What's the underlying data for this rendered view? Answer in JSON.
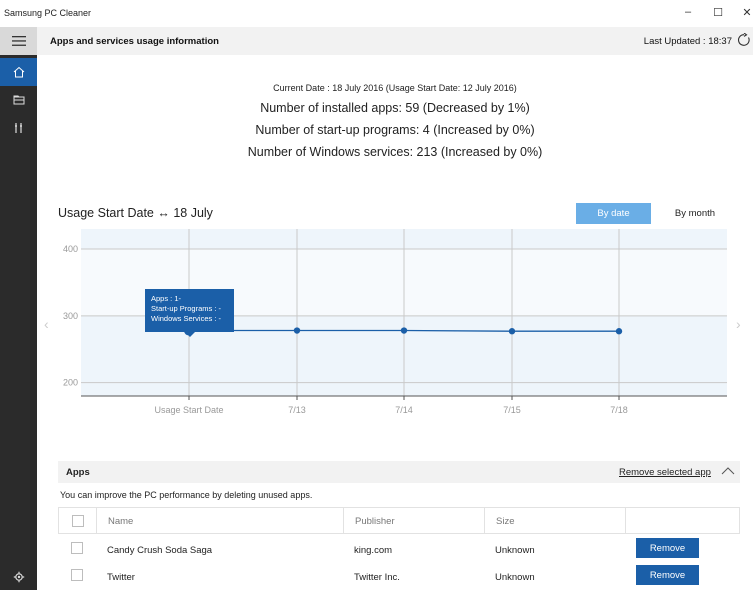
{
  "window": {
    "title": "Samsung PC Cleaner",
    "minimize": "–",
    "maximize": "☐",
    "close": "✕"
  },
  "header": {
    "title": "Apps and services usage information",
    "last_updated": "Last Updated : 18:37"
  },
  "summary": {
    "current_date": "Current Date : 18 July 2016 (Usage Start Date: 12 July 2016)",
    "installed_apps": "Number of installed apps: 59 (Decreased by 1%)",
    "startup_programs": "Number of start-up programs: 4 (Increased by 0%)",
    "windows_services": "Number of Windows services: 213 (Increased by 0%)"
  },
  "chart_header": {
    "title": "Usage Start Date ↔ 18 July",
    "by_date": "By date",
    "by_month": "By month"
  },
  "chart_data": {
    "type": "line",
    "x": [
      "Usage Start Date",
      "7/13",
      "7/14",
      "7/15",
      "7/18"
    ],
    "series": [
      {
        "values": [
          278,
          278,
          278,
          277,
          277
        ]
      }
    ],
    "ylim": [
      180,
      430
    ],
    "yticks": [
      200,
      300,
      400
    ],
    "grid": true,
    "color": "#1b5fa8"
  },
  "tooltip": {
    "apps": "Apps : 1-",
    "startup": "Start-up Programs : -",
    "services": "Windows Services : -"
  },
  "apps": {
    "title": "Apps",
    "remove_selected": "Remove selected app",
    "description": "You can improve the PC performance by deleting unused apps.",
    "columns": [
      "Name",
      "Publisher",
      "Size"
    ],
    "rows": [
      {
        "name": "Candy Crush Soda Saga",
        "publisher": "king.com",
        "size": "Unknown",
        "action": "Remove"
      },
      {
        "name": "Twitter",
        "publisher": "Twitter Inc.",
        "size": "Unknown",
        "action": "Remove"
      }
    ]
  }
}
